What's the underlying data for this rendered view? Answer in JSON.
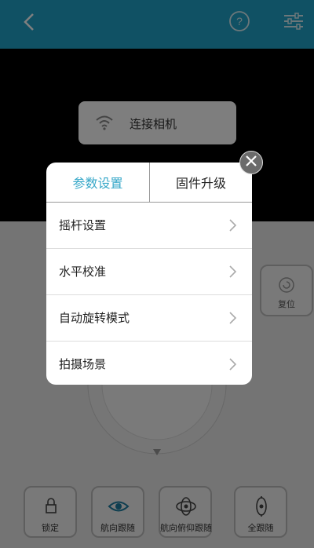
{
  "header": {
    "back_icon": "chevron-left-icon",
    "help_icon": "question-circle-icon",
    "settings_icon": "sliders-icon"
  },
  "camera": {
    "connect_label": "连接相机",
    "wifi_icon": "wifi-icon"
  },
  "side": {
    "reset_label": "复位"
  },
  "modes": [
    {
      "label": "锁定",
      "icon": "lock-icon"
    },
    {
      "label": "航向跟随",
      "icon": "eye-icon"
    },
    {
      "label": "航向俯仰跟随",
      "icon": "orbit-icon"
    },
    {
      "label": "全跟随",
      "icon": "full-follow-icon"
    }
  ],
  "popup": {
    "tabs": [
      {
        "label": "参数设置",
        "active": true
      },
      {
        "label": "固件升级",
        "active": false
      }
    ],
    "items": [
      {
        "label": "摇杆设置"
      },
      {
        "label": "水平校准"
      },
      {
        "label": "自动旋转模式"
      },
      {
        "label": "拍摄场景"
      }
    ]
  },
  "colors": {
    "accent": "#20a3c8",
    "tab_active": "#35a7c8"
  }
}
